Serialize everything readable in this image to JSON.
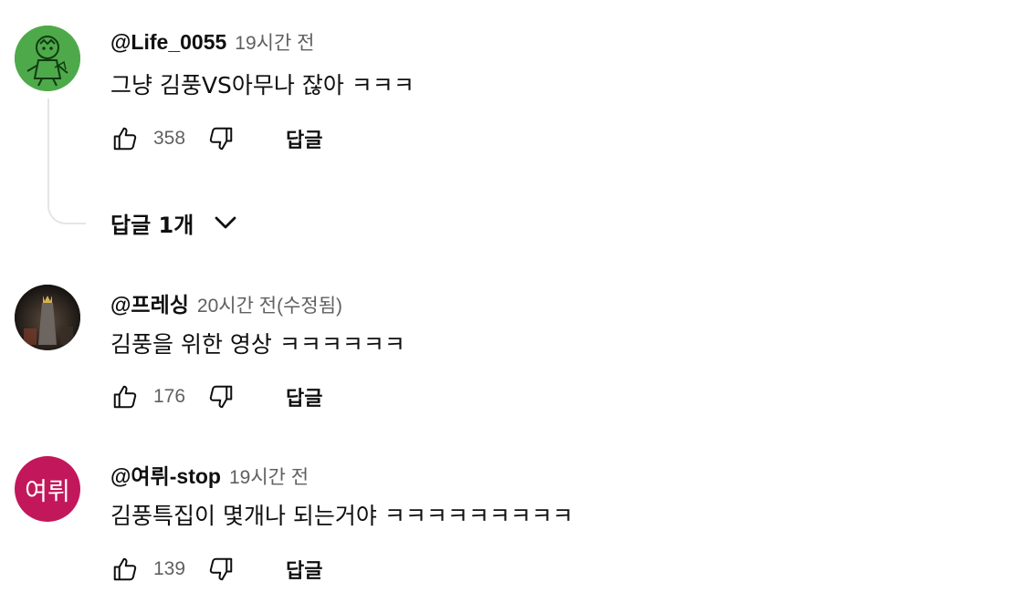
{
  "comments": [
    {
      "author": "@Life_0055",
      "time": "19시간 전",
      "text": "그냥 김풍VS아무나 잖아 ㅋㅋㅋ",
      "likes": "358",
      "reply_label": "답글",
      "avatar": {
        "type": "drawing-icon",
        "color": "#4ea94a"
      }
    },
    {
      "author": "@프레싱",
      "time": "20시간 전(수정됨)",
      "text": "김풍을 위한 영상 ㅋㅋㅋㅋㅋㅋ",
      "likes": "176",
      "reply_label": "답글",
      "avatar": {
        "type": "photo-icon",
        "color": "#1e1a17"
      }
    },
    {
      "author": "@여뤼-stop",
      "time": "19시간 전",
      "text": "김풍특집이 몇개나 되는거야 ㅋㅋㅋㅋㅋㅋㅋㅋㅋ",
      "likes": "139",
      "reply_label": "답글",
      "avatar": {
        "type": "letter",
        "letter": "여뤼",
        "color": "#c2185b"
      }
    }
  ],
  "replies_toggle": {
    "label": "답글 1개",
    "icon": "chevron-down-icon"
  },
  "icons": {
    "like": "thumbs-up-icon",
    "dislike": "thumbs-down-icon"
  }
}
